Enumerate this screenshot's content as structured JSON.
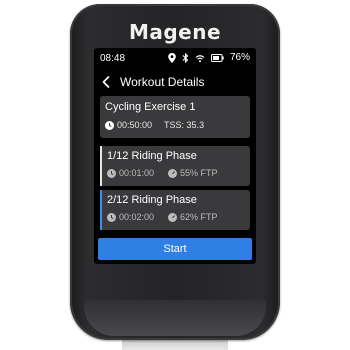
{
  "device": {
    "brand": "Magene"
  },
  "status_bar": {
    "time": "08:48",
    "battery": "76%",
    "icons": [
      "location-icon",
      "bluetooth-icon",
      "wifi-icon",
      "battery-icon"
    ]
  },
  "header": {
    "title": "Workout Details",
    "back_icon": "chevron-left-icon"
  },
  "summary": {
    "title": "Cycling Exercise 1",
    "duration": "00:50:00",
    "tss": "TSS: 35.3"
  },
  "phases": [
    {
      "title": "1/12 Riding Phase",
      "duration": "00:01:00",
      "intensity": "55% FTP",
      "active": false
    },
    {
      "title": "2/12 Riding Phase",
      "duration": "00:02:00",
      "intensity": "62% FTP",
      "active": true
    }
  ],
  "start_button": {
    "label": "Start"
  },
  "colors": {
    "screen_bg": "#000000",
    "card_bg": "#3a3a3d",
    "accent_blue": "#2f7fe4",
    "body": "#242426"
  }
}
